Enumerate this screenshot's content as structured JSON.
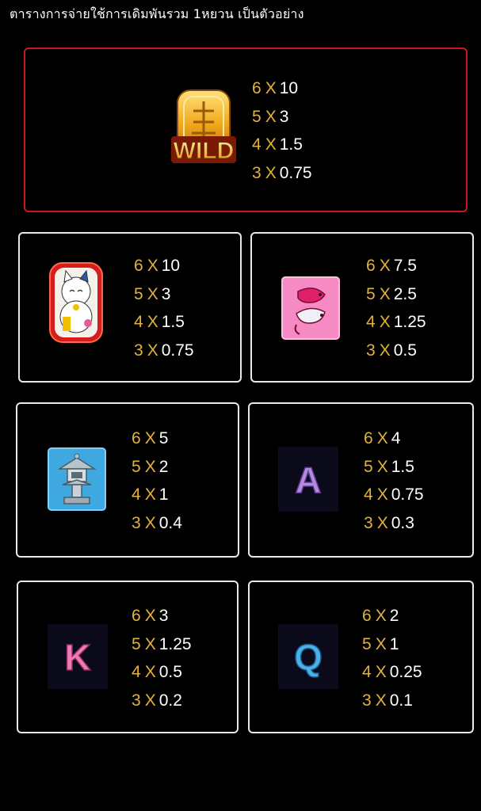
{
  "header": {
    "title": "ตารางการจ่ายใช้การเดิมพันรวม 1หยวน เป็นตัวอย่าง"
  },
  "symbols": [
    {
      "name": "wild",
      "icon": "wild-coin-icon",
      "label": "WILD",
      "pays": [
        {
          "count": "6",
          "x": "X",
          "mult": "10"
        },
        {
          "count": "5",
          "x": "X",
          "mult": "3"
        },
        {
          "count": "4",
          "x": "X",
          "mult": "1.5"
        },
        {
          "count": "3",
          "x": "X",
          "mult": "0.75"
        }
      ]
    },
    {
      "name": "lucky-cat",
      "icon": "lucky-cat-icon",
      "pays": [
        {
          "count": "6",
          "x": "X",
          "mult": "10"
        },
        {
          "count": "5",
          "x": "X",
          "mult": "3"
        },
        {
          "count": "4",
          "x": "X",
          "mult": "1.5"
        },
        {
          "count": "3",
          "x": "X",
          "mult": "0.75"
        }
      ]
    },
    {
      "name": "koi",
      "icon": "koi-fish-icon",
      "pays": [
        {
          "count": "6",
          "x": "X",
          "mult": "7.5"
        },
        {
          "count": "5",
          "x": "X",
          "mult": "2.5"
        },
        {
          "count": "4",
          "x": "X",
          "mult": "1.25"
        },
        {
          "count": "3",
          "x": "X",
          "mult": "0.5"
        }
      ]
    },
    {
      "name": "lantern",
      "icon": "stone-lantern-icon",
      "pays": [
        {
          "count": "6",
          "x": "X",
          "mult": "5"
        },
        {
          "count": "5",
          "x": "X",
          "mult": "2"
        },
        {
          "count": "4",
          "x": "X",
          "mult": "1"
        },
        {
          "count": "3",
          "x": "X",
          "mult": "0.4"
        }
      ]
    },
    {
      "name": "letter-a",
      "icon": "letter-a-icon",
      "label": "A",
      "pays": [
        {
          "count": "6",
          "x": "X",
          "mult": "4"
        },
        {
          "count": "5",
          "x": "X",
          "mult": "1.5"
        },
        {
          "count": "4",
          "x": "X",
          "mult": "0.75"
        },
        {
          "count": "3",
          "x": "X",
          "mult": "0.3"
        }
      ]
    },
    {
      "name": "letter-k",
      "icon": "letter-k-icon",
      "label": "K",
      "pays": [
        {
          "count": "6",
          "x": "X",
          "mult": "3"
        },
        {
          "count": "5",
          "x": "X",
          "mult": "1.25"
        },
        {
          "count": "4",
          "x": "X",
          "mult": "0.5"
        },
        {
          "count": "3",
          "x": "X",
          "mult": "0.2"
        }
      ]
    },
    {
      "name": "letter-q",
      "icon": "letter-q-icon",
      "label": "Q",
      "pays": [
        {
          "count": "6",
          "x": "X",
          "mult": "2"
        },
        {
          "count": "5",
          "x": "X",
          "mult": "1"
        },
        {
          "count": "4",
          "x": "X",
          "mult": "0.25"
        },
        {
          "count": "3",
          "x": "X",
          "mult": "0.1"
        }
      ]
    }
  ],
  "colors": {
    "count": "#e2b33a",
    "multiplier": "#ffffff",
    "wild_border": "#c8181d",
    "card_border": "#e8e8e8"
  }
}
